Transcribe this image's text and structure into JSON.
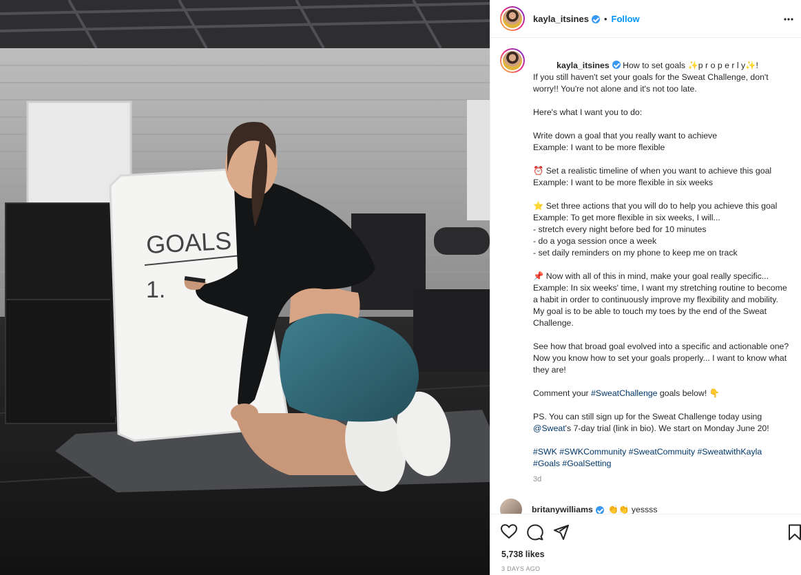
{
  "post": {
    "username": "kayla_itsines",
    "follow_label": "Follow",
    "dot": "•",
    "more_label": "•••",
    "photo_board_text": "GOALS",
    "photo_board_item": "1."
  },
  "caption": {
    "username": "kayla_itsines",
    "lines": [
      {
        "text": "How to set goals ✨p r o p e r l y✨!"
      },
      {
        "text": "If you still haven't set your goals for the Sweat Challenge, don't worry!! You're not alone and it's not too late."
      },
      {
        "text": ""
      },
      {
        "text": "Here's what I want you to do:"
      },
      {
        "text": ""
      },
      {
        "text": "Write down a goal that you really want to achieve"
      },
      {
        "text": "Example: I want to be more flexible"
      },
      {
        "text": ""
      },
      {
        "text": "⏰ Set a realistic timeline of when you want to achieve this goal"
      },
      {
        "text": "Example: I want to be more flexible in six weeks"
      },
      {
        "text": ""
      },
      {
        "text": "⭐ Set three actions that you will do to help you achieve this goal"
      },
      {
        "text": "Example: To get more flexible in six weeks, I will..."
      },
      {
        "text": "- stretch every night before bed for 10 minutes"
      },
      {
        "text": "- do a yoga session once a week"
      },
      {
        "text": "- set daily reminders on my phone to keep me on track"
      },
      {
        "text": ""
      },
      {
        "text": "📌 Now with all of this in mind, make your goal really specific..."
      },
      {
        "text": "Example: In six weeks' time, I want my stretching routine to become a habit in order to continuously improve my flexibility and mobility. My goal is to be able to touch my toes by the end of the Sweat Challenge."
      },
      {
        "text": ""
      },
      {
        "text": "See how that broad goal evolved into a specific and actionable one? Now you know how to set your goals properly... I want to know what they are!"
      },
      {
        "text": ""
      }
    ],
    "comment_prefix": "Comment your ",
    "comment_tag": "#SweatChallenge",
    "comment_suffix": " goals below! 👇",
    "ps_line": "PS. You can still sign up for the Sweat Challenge today using ",
    "ps_mention": "@Sweat",
    "ps_suffix": "'s 7-day trial (link in bio). We start on Monday June 20!",
    "hashtags": [
      "#SWK",
      "#SWKCommunity",
      "#SweatCommuity",
      "#SweatwithKayla",
      "#Goals",
      "#GoalSetting"
    ],
    "age": "3d"
  },
  "comment": {
    "username": "britanywilliams",
    "text": "👏👏 yessss"
  },
  "actions": {
    "likes": "5,738 likes",
    "date": "3 DAYS AGO"
  },
  "colors": {
    "accent": "#0095f6",
    "verified": "#3897f0",
    "hashtag": "#00376b",
    "secondary_text": "#8e8e8e"
  },
  "icons": [
    "heart-icon",
    "comment-icon",
    "share-icon",
    "bookmark-icon",
    "more-icon",
    "verified-icon"
  ]
}
